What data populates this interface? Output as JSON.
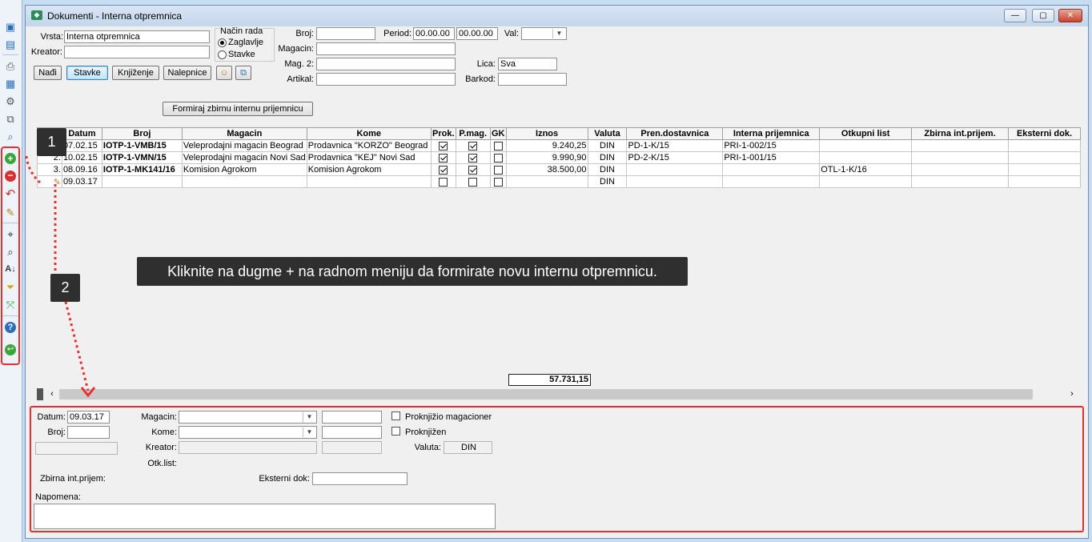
{
  "window": {
    "title": "Dokumenti - Interna otpremnica",
    "minimize": "—",
    "maximize": "▢",
    "close": "✕"
  },
  "form": {
    "vrsta_label": "Vrsta:",
    "vrsta_value": "Interna otpremnica",
    "kreator_label": "Kreator:",
    "kreator_value": "",
    "nacin_rada_label": "Način rada",
    "zaglavlje_label": "Zaglavlje",
    "stavke_radio_label": "Stavke",
    "broj_label": "Broj:",
    "broj_value": "",
    "period_label": "Period:",
    "period_from": "00.00.00",
    "period_to": "00.00.00",
    "val_label": "Val:",
    "val_value": "",
    "magacin_label": "Magacin:",
    "magacin_value": "",
    "mag2_label": "Mag. 2:",
    "mag2_value": "",
    "lica_label": "Lica:",
    "lica_value": "Sva",
    "artikal_label": "Artikal:",
    "artikal_value": "",
    "barkod_label": "Barkod:",
    "barkod_value": ""
  },
  "buttons": {
    "nadji": "Nađi",
    "stavke": "Stavke",
    "knjizenje": "Knjiženje",
    "nalepnice": "Nalepnice",
    "formiraj": "Formiraj zbirnu internu prijemnicu"
  },
  "grid": {
    "columns": [
      "",
      "Datum",
      "Broj",
      "Magacin",
      "Kome",
      "Prok.",
      "P.mag.",
      "GK",
      "Iznos",
      "Valuta",
      "Pren.dostavnica",
      "Interna prijemnica",
      "Otkupni list",
      "Zbirna int.prijem.",
      "Eksterni dok."
    ],
    "rows": [
      {
        "rb": "1.",
        "datum": "07.02.15",
        "broj": "IOTP-1-VMB/15",
        "magacin": "Veleprodajni magacin Beograd",
        "kome": "Prodavnica \"KORZO\" Beograd",
        "iznos": "9.240,25",
        "valuta": "DIN",
        "pren": "PD-1-K/15",
        "interna": "PRI-1-002/15",
        "otkupni": ""
      },
      {
        "rb": "2.",
        "datum": "10.02.15",
        "broj": "IOTP-1-VMN/15",
        "magacin": "Veleprodajni magacin Novi Sad",
        "kome": "Prodavnica \"KEJ\" Novi Sad",
        "iznos": "9.990,90",
        "valuta": "DIN",
        "pren": "PD-2-K/15",
        "interna": "PRI-1-001/15",
        "otkupni": ""
      },
      {
        "rb": "3.",
        "datum": "08.09.16",
        "broj": "IOTP-1-MK141/16",
        "magacin": "Komision Agrokom",
        "kome": "Komision Agrokom",
        "iznos": "38.500,00",
        "valuta": "DIN",
        "pren": "",
        "interna": "",
        "otkupni": "OTL-1-K/16"
      },
      {
        "rb": "",
        "datum": "09.03.17",
        "broj": "",
        "magacin": "",
        "kome": "",
        "iznos": "",
        "valuta": "DIN",
        "pren": "",
        "interna": "",
        "otkupni": ""
      }
    ],
    "total": "57.731,15"
  },
  "detail": {
    "datum_label": "Datum:",
    "datum_value": "09.03.17",
    "broj_label": "Broj:",
    "broj_value": "",
    "magacin_label": "Magacin:",
    "kome_label": "Kome:",
    "kreator_label": "Kreator:",
    "otk_label": "Otk.list:",
    "zbirna_label": "Zbirna int.prijem:",
    "eksterni_label": "Eksterni dok:",
    "valuta_label": "Valuta:",
    "valuta_value": "DIN",
    "proknjizio_label": "Proknjižio magacioner",
    "proknjizen_label": "Proknjižen",
    "napomena_label": "Napomena:"
  },
  "overlay": {
    "badge1": "1",
    "badge2": "2",
    "tooltip": "Kliknite na dugme + na radnom meniju da formirate novu internu otpremnicu."
  },
  "colors": {
    "highlight": "#e53030",
    "tooltip_bg": "#2f2f2f"
  }
}
